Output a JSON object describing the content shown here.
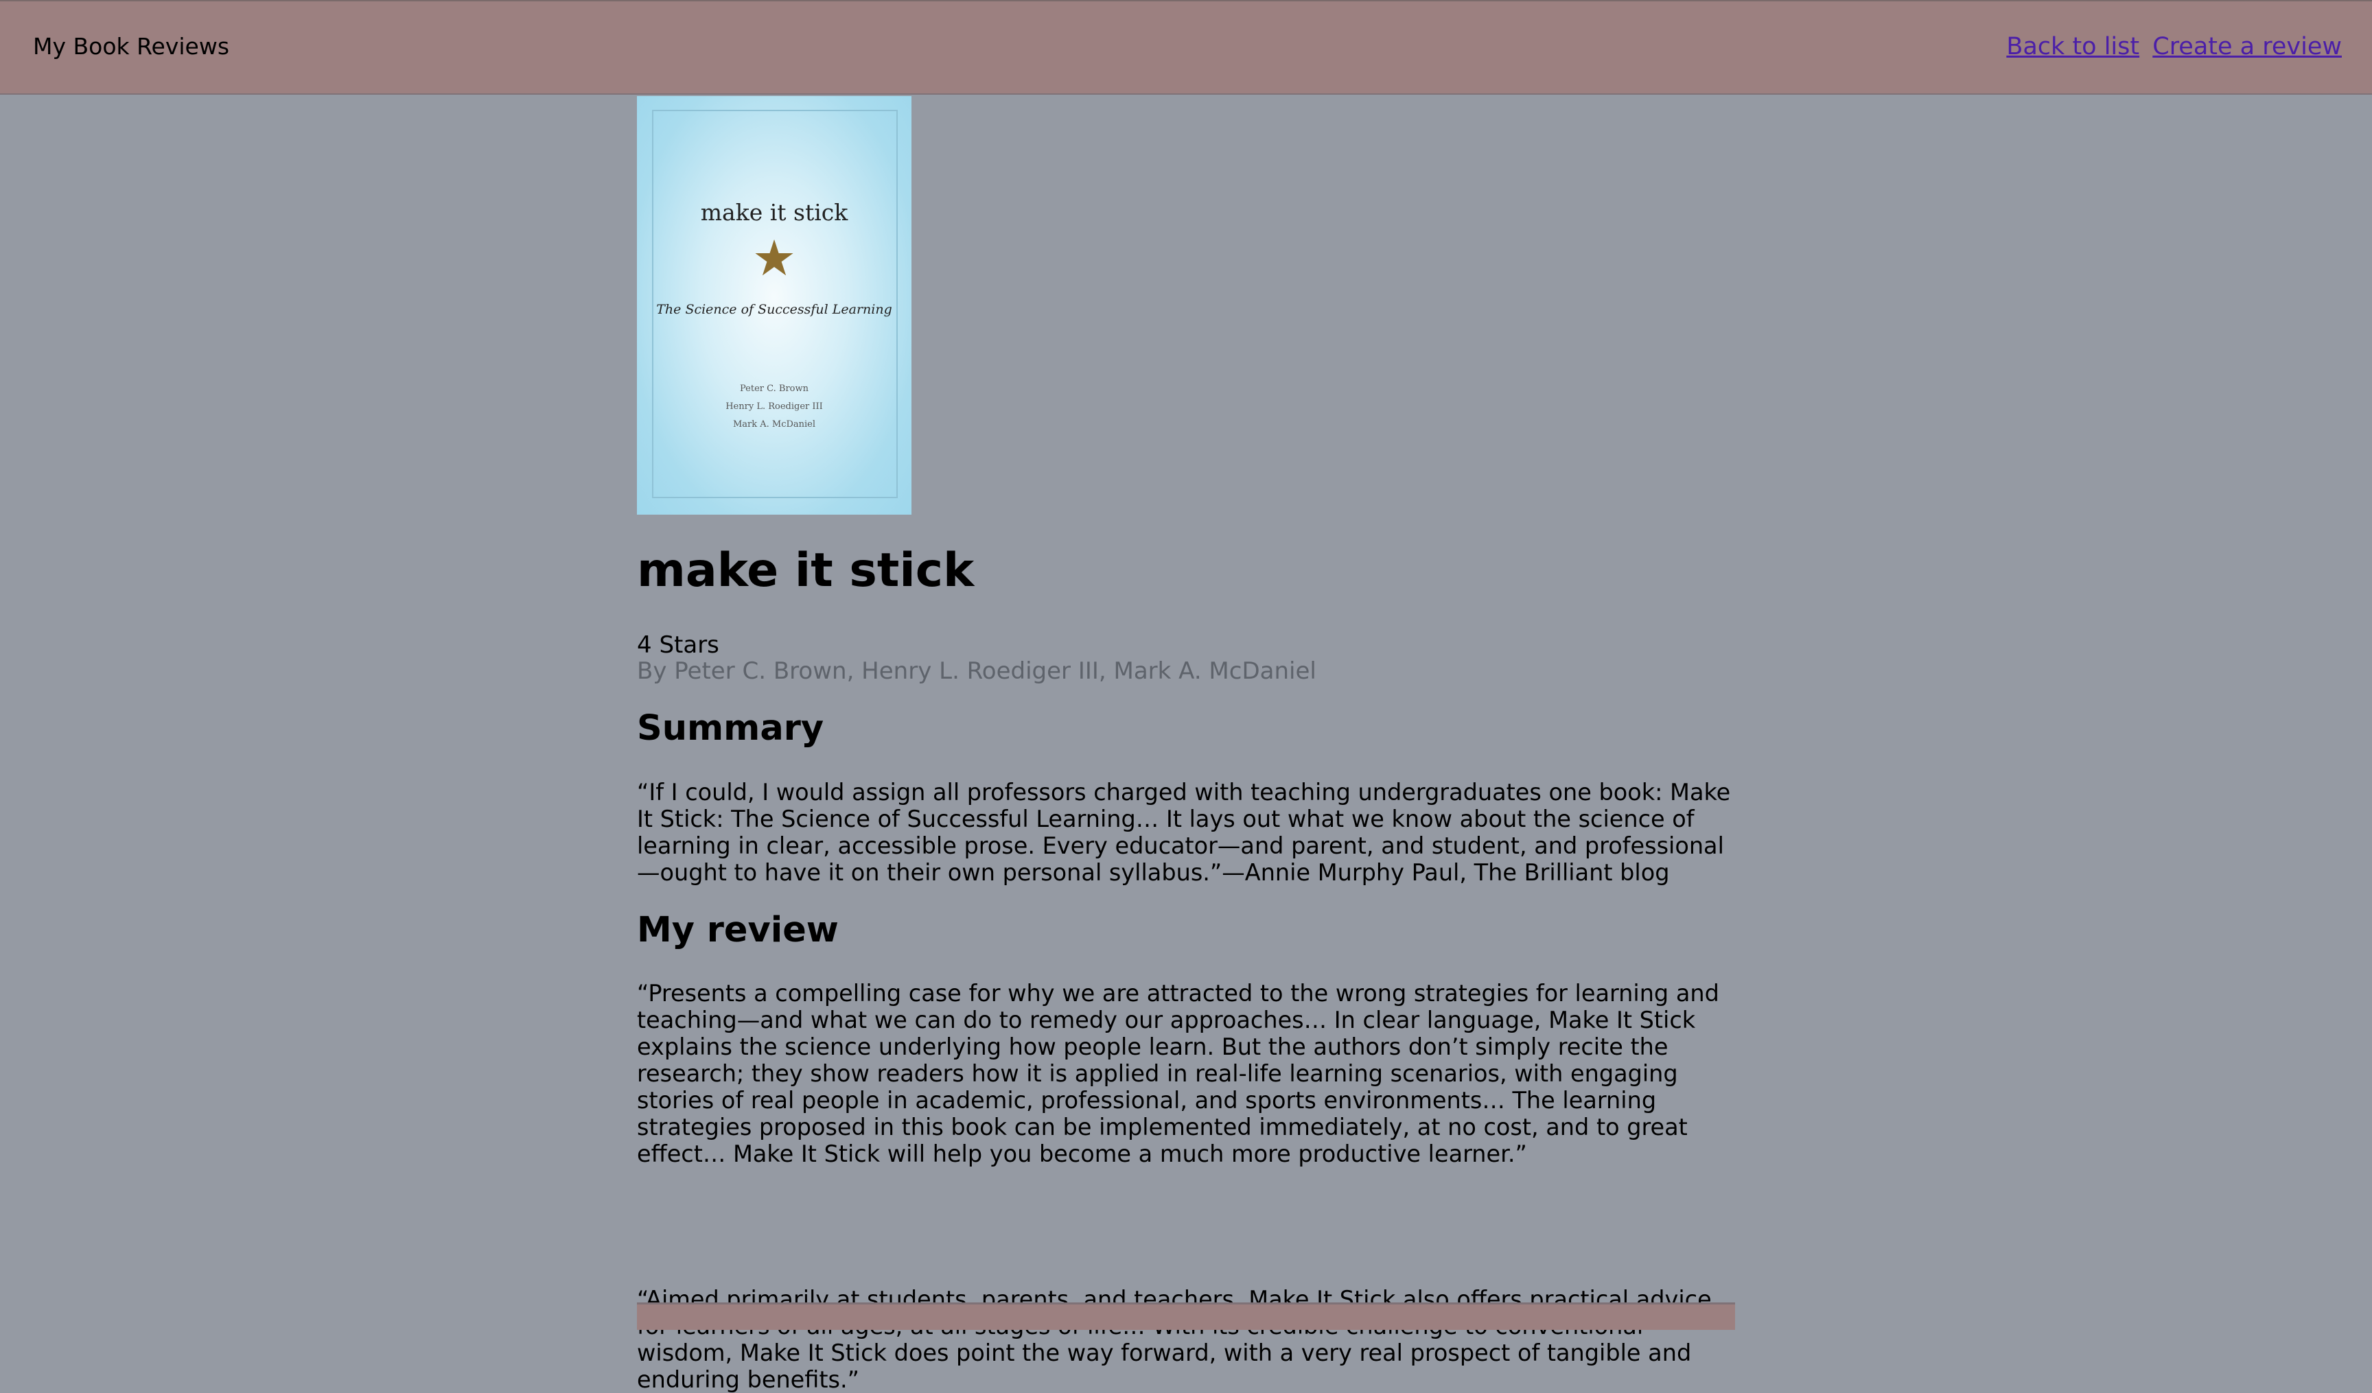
{
  "header": {
    "brand": "My Book Reviews",
    "nav": {
      "back_label": "Back to list",
      "create_label": "Create a review"
    }
  },
  "book": {
    "cover": {
      "title": "make it stick",
      "subtitle": "The Science of Successful Learning",
      "authors": [
        "Peter C. Brown",
        "Henry L. Roediger III",
        "Mark A. McDaniel"
      ],
      "star_icon": "star-icon",
      "colors": {
        "background": "#a9dcee",
        "star": "#8d6e2f"
      }
    },
    "title": "make it stick",
    "rating_text": "4 Stars",
    "byline": "By Peter C. Brown, Henry L. Roediger III, Mark A. McDaniel"
  },
  "summary": {
    "heading": "Summary",
    "text": "“If I could, I would assign all professors charged with teaching undergraduates one book: Make It Stick: The Science of Successful Learning… It lays out what we know about the science of learning in clear, accessible prose. Every educator—and parent, and student, and professional—ought to have it on their own personal syllabus.”—Annie Murphy Paul, The Brilliant blog"
  },
  "review": {
    "heading": "My review",
    "paragraphs": [
      "“Presents a compelling case for why we are attracted to the wrong strategies for learning and teaching—and what we can do to remedy our approaches… In clear language, Make It Stick explains the science underlying how people learn. But the authors don’t simply recite the research; they show readers how it is applied in real-life learning scenarios, with engaging stories of real people in academic, professional, and sports environments… The learning strategies proposed in this book can be implemented immediately, at no cost, and to great effect… Make It Stick will help you become a much more productive learner.”",
      "“Aimed primarily at students, parents, and teachers, Make It Stick also offers practical advice for learners of all ages, at all stages of life… With its credible challenge to conventional wisdom, Make It Stick does point the way forward, with a very real prospect of tangible and enduring benefits.”"
    ]
  },
  "theme": {
    "page_background": "#959aa3",
    "header_background": "#9c8080",
    "link_color": "#4b1fa8",
    "byline_color": "#5e636b"
  }
}
